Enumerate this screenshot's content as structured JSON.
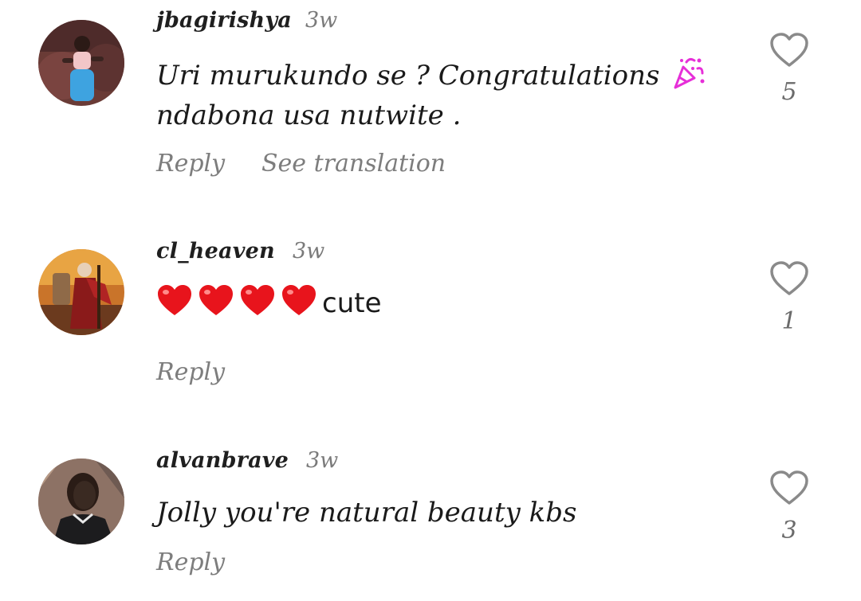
{
  "comments": [
    {
      "username": "jbagirishya",
      "time": "3w",
      "text_line1": "Uri murukundo se ? Congratulations",
      "text_emoji": "party-popper-icon",
      "text_line2": "ndabona usa nutwite .",
      "reply_label": "Reply",
      "translate_label": "See translation",
      "likes": "5"
    },
    {
      "username": "cl_heaven",
      "time": "3w",
      "text_emoji": "red-heart-icon x4",
      "text": "cute",
      "reply_label": "Reply",
      "likes": "1"
    },
    {
      "username": "alvanbrave",
      "time": "3w",
      "text": "Jolly you're natural beauty kbs",
      "reply_label": "Reply",
      "likes": "3"
    }
  ],
  "colors": {
    "username": "#1f1f1f",
    "meta": "#7a7a7a",
    "heart_emoji": "#e8141c",
    "party_popper": "#e62fd8",
    "like_outline": "#8a8a8a"
  }
}
